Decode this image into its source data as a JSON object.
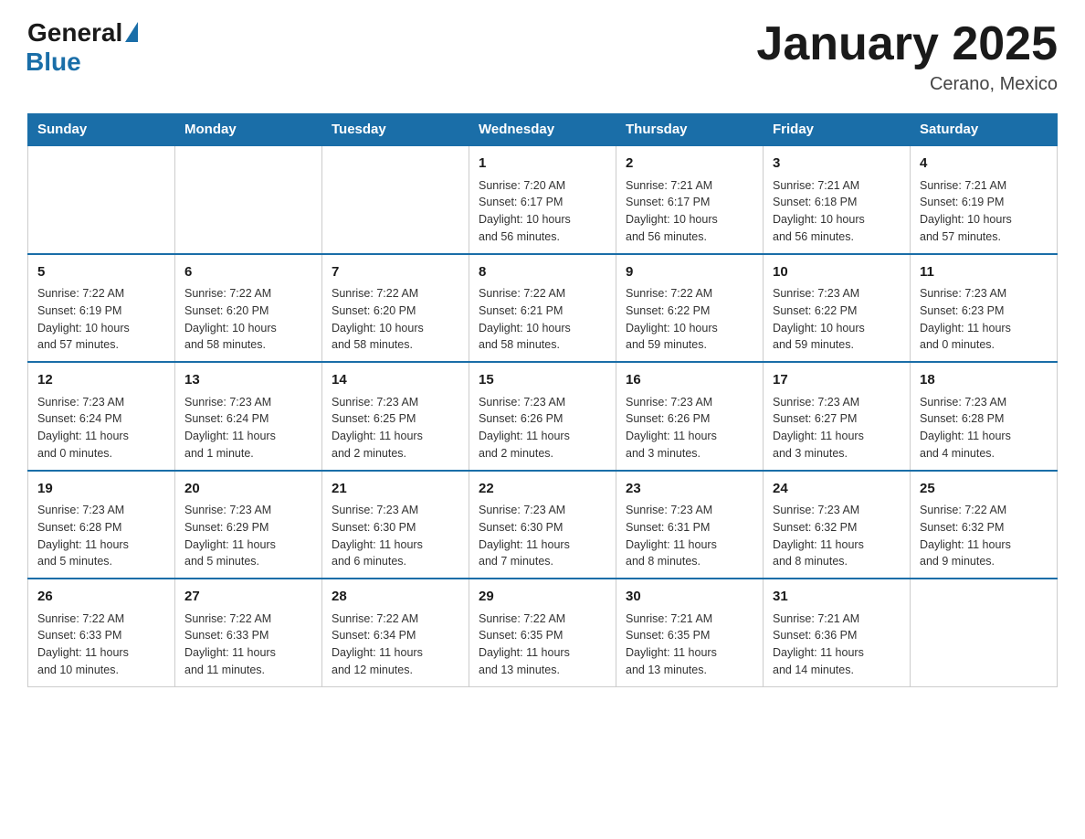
{
  "logo": {
    "general": "General",
    "blue": "Blue"
  },
  "title": "January 2025",
  "subtitle": "Cerano, Mexico",
  "days": [
    "Sunday",
    "Monday",
    "Tuesday",
    "Wednesday",
    "Thursday",
    "Friday",
    "Saturday"
  ],
  "weeks": [
    [
      {
        "num": "",
        "info": ""
      },
      {
        "num": "",
        "info": ""
      },
      {
        "num": "",
        "info": ""
      },
      {
        "num": "1",
        "info": "Sunrise: 7:20 AM\nSunset: 6:17 PM\nDaylight: 10 hours\nand 56 minutes."
      },
      {
        "num": "2",
        "info": "Sunrise: 7:21 AM\nSunset: 6:17 PM\nDaylight: 10 hours\nand 56 minutes."
      },
      {
        "num": "3",
        "info": "Sunrise: 7:21 AM\nSunset: 6:18 PM\nDaylight: 10 hours\nand 56 minutes."
      },
      {
        "num": "4",
        "info": "Sunrise: 7:21 AM\nSunset: 6:19 PM\nDaylight: 10 hours\nand 57 minutes."
      }
    ],
    [
      {
        "num": "5",
        "info": "Sunrise: 7:22 AM\nSunset: 6:19 PM\nDaylight: 10 hours\nand 57 minutes."
      },
      {
        "num": "6",
        "info": "Sunrise: 7:22 AM\nSunset: 6:20 PM\nDaylight: 10 hours\nand 58 minutes."
      },
      {
        "num": "7",
        "info": "Sunrise: 7:22 AM\nSunset: 6:20 PM\nDaylight: 10 hours\nand 58 minutes."
      },
      {
        "num": "8",
        "info": "Sunrise: 7:22 AM\nSunset: 6:21 PM\nDaylight: 10 hours\nand 58 minutes."
      },
      {
        "num": "9",
        "info": "Sunrise: 7:22 AM\nSunset: 6:22 PM\nDaylight: 10 hours\nand 59 minutes."
      },
      {
        "num": "10",
        "info": "Sunrise: 7:23 AM\nSunset: 6:22 PM\nDaylight: 10 hours\nand 59 minutes."
      },
      {
        "num": "11",
        "info": "Sunrise: 7:23 AM\nSunset: 6:23 PM\nDaylight: 11 hours\nand 0 minutes."
      }
    ],
    [
      {
        "num": "12",
        "info": "Sunrise: 7:23 AM\nSunset: 6:24 PM\nDaylight: 11 hours\nand 0 minutes."
      },
      {
        "num": "13",
        "info": "Sunrise: 7:23 AM\nSunset: 6:24 PM\nDaylight: 11 hours\nand 1 minute."
      },
      {
        "num": "14",
        "info": "Sunrise: 7:23 AM\nSunset: 6:25 PM\nDaylight: 11 hours\nand 2 minutes."
      },
      {
        "num": "15",
        "info": "Sunrise: 7:23 AM\nSunset: 6:26 PM\nDaylight: 11 hours\nand 2 minutes."
      },
      {
        "num": "16",
        "info": "Sunrise: 7:23 AM\nSunset: 6:26 PM\nDaylight: 11 hours\nand 3 minutes."
      },
      {
        "num": "17",
        "info": "Sunrise: 7:23 AM\nSunset: 6:27 PM\nDaylight: 11 hours\nand 3 minutes."
      },
      {
        "num": "18",
        "info": "Sunrise: 7:23 AM\nSunset: 6:28 PM\nDaylight: 11 hours\nand 4 minutes."
      }
    ],
    [
      {
        "num": "19",
        "info": "Sunrise: 7:23 AM\nSunset: 6:28 PM\nDaylight: 11 hours\nand 5 minutes."
      },
      {
        "num": "20",
        "info": "Sunrise: 7:23 AM\nSunset: 6:29 PM\nDaylight: 11 hours\nand 5 minutes."
      },
      {
        "num": "21",
        "info": "Sunrise: 7:23 AM\nSunset: 6:30 PM\nDaylight: 11 hours\nand 6 minutes."
      },
      {
        "num": "22",
        "info": "Sunrise: 7:23 AM\nSunset: 6:30 PM\nDaylight: 11 hours\nand 7 minutes."
      },
      {
        "num": "23",
        "info": "Sunrise: 7:23 AM\nSunset: 6:31 PM\nDaylight: 11 hours\nand 8 minutes."
      },
      {
        "num": "24",
        "info": "Sunrise: 7:23 AM\nSunset: 6:32 PM\nDaylight: 11 hours\nand 8 minutes."
      },
      {
        "num": "25",
        "info": "Sunrise: 7:22 AM\nSunset: 6:32 PM\nDaylight: 11 hours\nand 9 minutes."
      }
    ],
    [
      {
        "num": "26",
        "info": "Sunrise: 7:22 AM\nSunset: 6:33 PM\nDaylight: 11 hours\nand 10 minutes."
      },
      {
        "num": "27",
        "info": "Sunrise: 7:22 AM\nSunset: 6:33 PM\nDaylight: 11 hours\nand 11 minutes."
      },
      {
        "num": "28",
        "info": "Sunrise: 7:22 AM\nSunset: 6:34 PM\nDaylight: 11 hours\nand 12 minutes."
      },
      {
        "num": "29",
        "info": "Sunrise: 7:22 AM\nSunset: 6:35 PM\nDaylight: 11 hours\nand 13 minutes."
      },
      {
        "num": "30",
        "info": "Sunrise: 7:21 AM\nSunset: 6:35 PM\nDaylight: 11 hours\nand 13 minutes."
      },
      {
        "num": "31",
        "info": "Sunrise: 7:21 AM\nSunset: 6:36 PM\nDaylight: 11 hours\nand 14 minutes."
      },
      {
        "num": "",
        "info": ""
      }
    ]
  ]
}
